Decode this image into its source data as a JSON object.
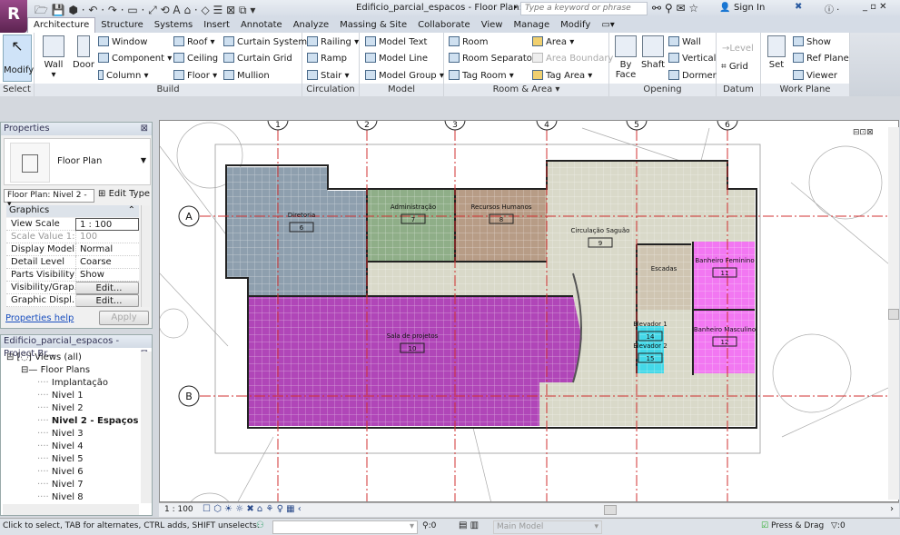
{
  "app": {
    "title": "Edificio_parcial_espacos - Floor Plan: ...",
    "search_placeholder": "Type a keyword or phrase",
    "sign_in": "Sign In",
    "logo": "R"
  },
  "tabs": [
    "Architecture",
    "Structure",
    "Systems",
    "Insert",
    "Annotate",
    "Analyze",
    "Massing & Site",
    "Collaborate",
    "View",
    "Manage",
    "Modify"
  ],
  "ribbon": {
    "select": {
      "modify": "Modify",
      "label": "Select"
    },
    "build": {
      "wall": "Wall",
      "door": "Door",
      "window": "Window",
      "component": "Component",
      "column": "Column",
      "roof": "Roof",
      "ceiling": "Ceiling",
      "floor": "Floor",
      "curtain_system": "Curtain System",
      "curtain_grid": "Curtain Grid",
      "mullion": "Mullion",
      "label": "Build"
    },
    "circulation": {
      "railing": "Railing",
      "ramp": "Ramp",
      "stair": "Stair",
      "label": "Circulation"
    },
    "model": {
      "model_text": "Model Text",
      "model_line": "Model Line",
      "model_group": "Model Group",
      "label": "Model"
    },
    "room_area": {
      "room": "Room",
      "room_separator": "Room Separator",
      "tag_room": "Tag Room",
      "area": "Area",
      "area_boundary": "Area Boundary",
      "tag_area": "Tag Area",
      "label": "Room & Area ▾"
    },
    "opening": {
      "by_face": "By Face",
      "shaft": "Shaft",
      "wall": "Wall",
      "vertical": "Vertical",
      "dormer": "Dormer",
      "label": "Opening"
    },
    "datum": {
      "level": "Level",
      "grid": "Grid",
      "label": "Datum"
    },
    "work_plane": {
      "set": "Set",
      "show": "Show",
      "ref_plane": "Ref Plane",
      "viewer": "Viewer",
      "label": "Work Plane"
    }
  },
  "properties": {
    "title": "Properties",
    "type": "Floor Plan",
    "selector": "Floor Plan: Nivel 2 -",
    "edit_type": "Edit Type",
    "group": "Graphics",
    "rows": [
      {
        "k": "View Scale",
        "v": "1 : 100"
      },
      {
        "k": "Scale Value    1:",
        "v": "100"
      },
      {
        "k": "Display Model",
        "v": "Normal"
      },
      {
        "k": "Detail Level",
        "v": "Coarse"
      },
      {
        "k": "Parts Visibility",
        "v": "Show Original"
      },
      {
        "k": "Visibility/Grap...",
        "v": "Edit..."
      },
      {
        "k": "Graphic Displ...",
        "v": "Edit..."
      }
    ],
    "help": "Properties help",
    "apply": "Apply"
  },
  "browser": {
    "title": "Edificio_parcial_espacos - Project Br...",
    "root": "Views (all)",
    "group": "Floor Plans",
    "items": [
      "Implantação",
      "Nivel 1",
      "Nivel 2",
      "Nivel 2 - Espaços",
      "Nivel 3",
      "Nivel 4",
      "Nivel 5",
      "Nivel 6",
      "Nivel 7",
      "Nivel 8"
    ],
    "active": "Nivel 2 - Espaços"
  },
  "plan": {
    "rooms": [
      {
        "name": "Diretoria",
        "number": "6",
        "color": "#8e9fae"
      },
      {
        "name": "Administração",
        "number": "7",
        "color": "#8fae88"
      },
      {
        "name": "Recursos Humanos",
        "number": "8",
        "color": "#b79c86"
      },
      {
        "name": "Circulação Saguão",
        "number": "9",
        "color": "#d9d9c9"
      },
      {
        "name": "Sala de projetos",
        "number": "10",
        "color": "#b046b8"
      },
      {
        "name": "Banheiro Feminino",
        "number": "11",
        "color": "#f277f2"
      },
      {
        "name": "Banheiro Masculino",
        "number": "12",
        "color": "#f277f2"
      },
      {
        "name": "Elevador 1",
        "number": "14",
        "color": "#44d8e8"
      },
      {
        "name": "Elevador 2",
        "number": "15",
        "color": "#44d8e8"
      },
      {
        "name": "Escadas",
        "number": "",
        "color": "#cfc5b2"
      }
    ],
    "grids": [
      "A",
      "B",
      "1",
      "2",
      "3",
      "4",
      "5",
      "6"
    ],
    "grid_color": "#d03030"
  },
  "viewbar": {
    "scale": "1 : 100"
  },
  "status": {
    "hint": "Click to select, TAB for alternates, CTRL adds, SHIFT unselects.",
    "count": ":0",
    "workset": "Main Model",
    "press_drag": "Press & Drag",
    "filter": ":0"
  }
}
